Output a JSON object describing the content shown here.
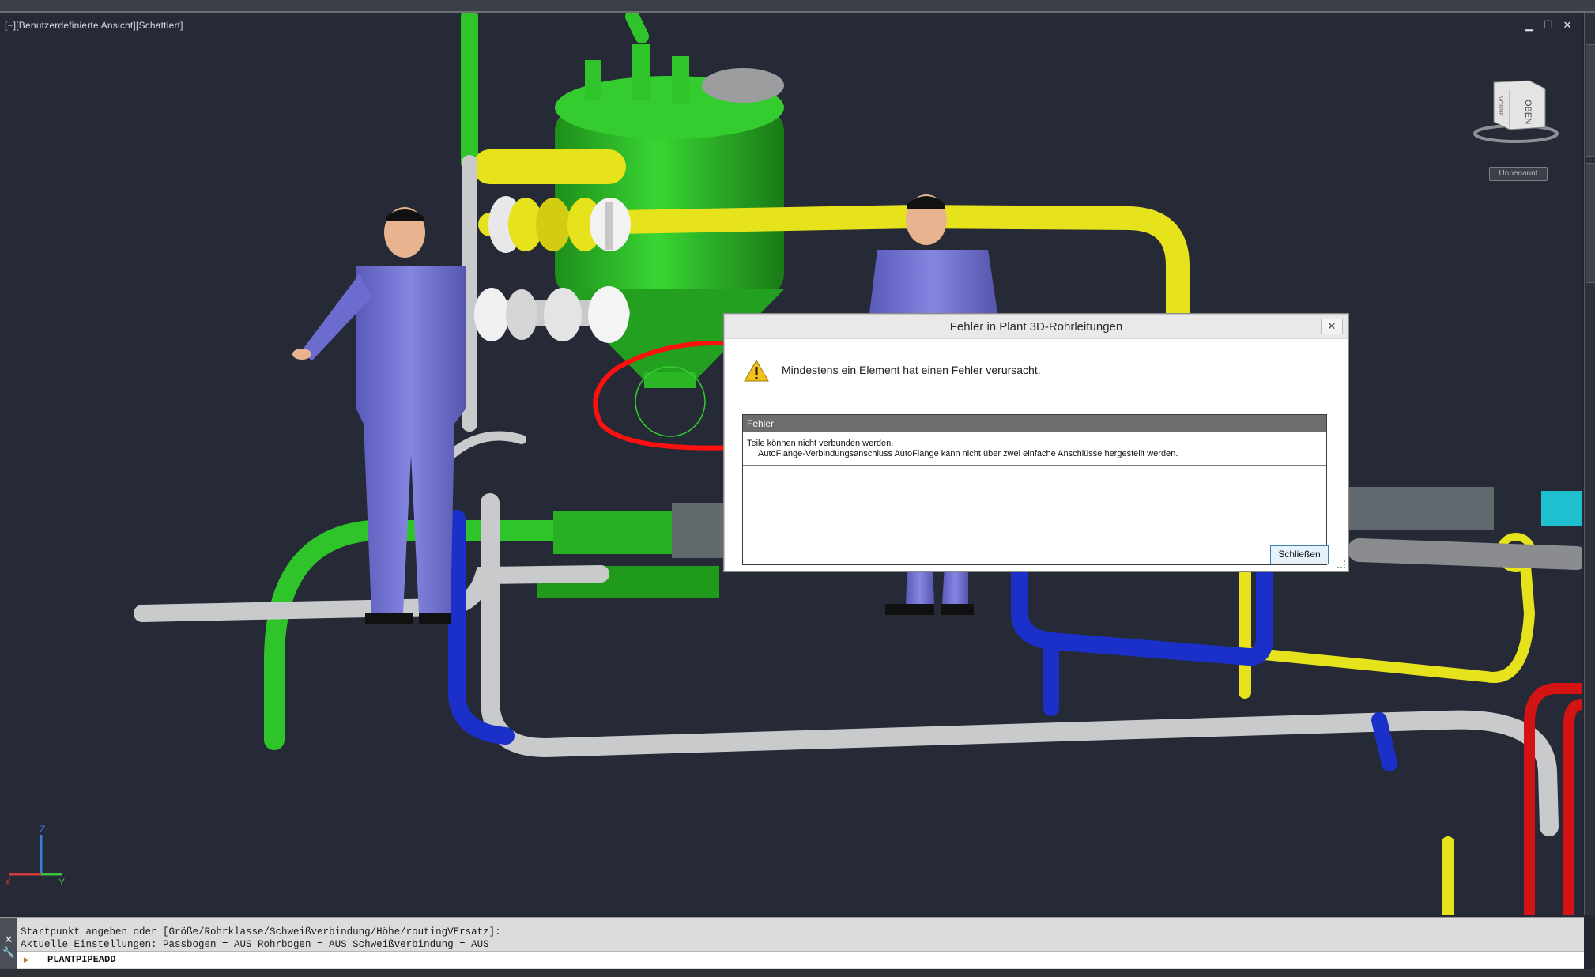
{
  "viewport": {
    "view_label": "[−][Benutzerdefinierte Ansicht][Schattiert]",
    "controls": {
      "minimize": "▁",
      "restore": "❐",
      "close": "✕"
    },
    "viewcube": {
      "face_top": "OBEN",
      "face_front": "VORNE",
      "named_view": "Unbenannt"
    },
    "ucs": {
      "x": "X",
      "y": "Y",
      "z": "Z"
    },
    "colors": {
      "background": "#252a36",
      "pipe_green": "#2fc52a",
      "pipe_yellow": "#e6e21c",
      "pipe_gray": "#c9cacc",
      "pipe_blue": "#1b2fc9",
      "pipe_red": "#d41414",
      "pipe_cyan": "#1ec0cf",
      "worker_suit": "#7474d6",
      "annotation_red": "#ff0000"
    }
  },
  "dialog": {
    "title": "Fehler in Plant 3D-Rohrleitungen",
    "close_icon": "✕",
    "warning_icon": "warning-triangle",
    "message": "Mindestens ein Element hat einen Fehler verursacht.",
    "error_header": "Fehler",
    "error_line": "Teile können nicht verbunden werden.",
    "error_detail": "AutoFlange-Verbindungsanschluss AutoFlange kann nicht über zwei einfache Anschlüsse hergestellt werden.",
    "close_button": "Schließen"
  },
  "command_line": {
    "close_icon": "✕",
    "wrench_icon": "wrench",
    "history": [
      "Startpunkt angeben oder [Größe/Rohrklasse/Schweißverbindung/Höhe/routingVErsatz]:",
      "Aktuelle Einstellungen: Passbogen = AUS Rohrbogen = AUS Schweißverbindung = AUS"
    ],
    "prompt_icon": "▸",
    "input": "PLANTPIPEADD"
  }
}
